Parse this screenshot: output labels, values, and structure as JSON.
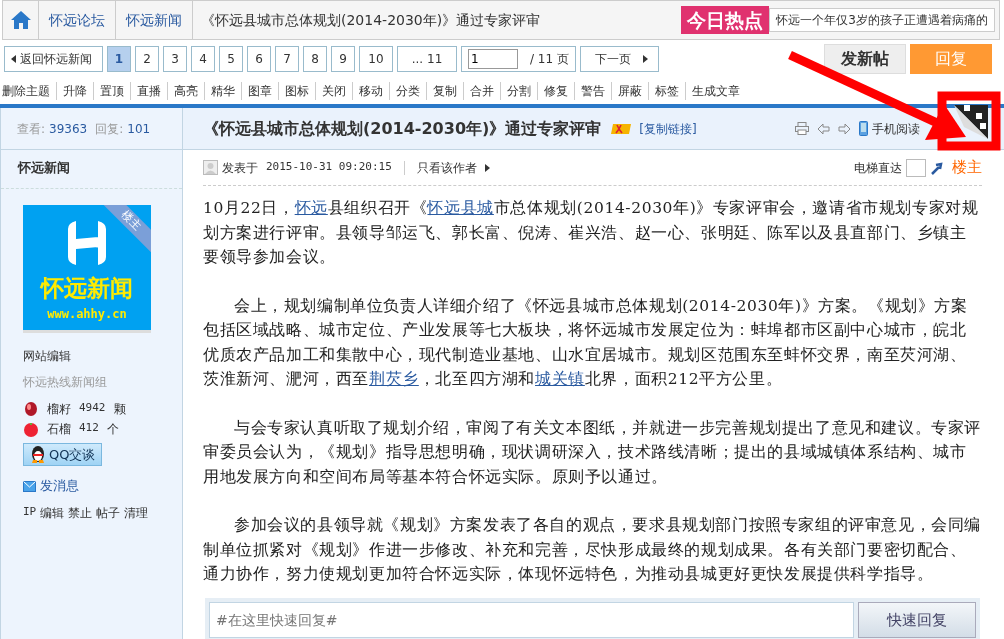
{
  "breadcrumb": {
    "items": [
      "怀远论坛",
      "怀远新闻"
    ],
    "current": "《怀远县城市总体规划(2014-2030年)》通过专家评审"
  },
  "hot": {
    "label": "今日热点",
    "headline": "怀远一个年仅3岁的孩子正遭遇着病痛的"
  },
  "pager": {
    "back": "返回怀远新闻",
    "pages": [
      {
        "label": "1",
        "selected": true
      },
      {
        "label": "2",
        "selected": false
      },
      {
        "label": "3",
        "selected": false
      },
      {
        "label": "4",
        "selected": false
      },
      {
        "label": "5",
        "selected": false
      },
      {
        "label": "6",
        "selected": false
      },
      {
        "label": "7",
        "selected": false
      },
      {
        "label": "8",
        "selected": false
      },
      {
        "label": "9",
        "selected": false
      },
      {
        "label": "10",
        "selected": false
      },
      {
        "label": "... 11",
        "selected": false
      }
    ],
    "page_input": "1",
    "total": "/ 11 页",
    "next": "下一页"
  },
  "actions": {
    "new_post": "发新帖",
    "reply": "回复"
  },
  "mod_tools": [
    "删除主题",
    "升降",
    "置顶",
    "直播",
    "高亮",
    "精华",
    "图章",
    "图标",
    "关闭",
    "移动",
    "分类",
    "复制",
    "合并",
    "分割",
    "修复",
    "警告",
    "屏蔽",
    "标签",
    "生成文章"
  ],
  "stats": {
    "views_label": "查看:",
    "views": "39363",
    "replies_label": "回复:",
    "replies": "101"
  },
  "author": {
    "name": "怀远新闻",
    "logo_text": "怀远新闻",
    "logo_url": "www.ahhy.cn",
    "ribbon": "楼主",
    "role": "网站编辑",
    "group": "怀远热线新闻组",
    "credits": [
      {
        "name": "榴籽",
        "value": "4942",
        "unit": "颗"
      },
      {
        "name": "石榴",
        "value": "412",
        "unit": "个"
      }
    ],
    "qq": "QQ交谈",
    "message": "发消息",
    "admin_label": "IP",
    "admin_links": [
      "编辑",
      "禁止",
      "帖子",
      "清理"
    ]
  },
  "post": {
    "title": "《怀远县城市总体规划(2014-2030年)》通过专家评审",
    "copy_link": "[复制链接]",
    "mobile": "手机阅读",
    "posted_label": "发表于",
    "posted_at": "2015-10-31 09:20:15",
    "author_only": "只看该作者",
    "jump_label": "电梯直达",
    "floor": "楼主",
    "paragraphs": [
      {
        "indent": false,
        "parts": [
          {
            "text": "10月22日，"
          },
          {
            "text": "怀远",
            "link": true
          },
          {
            "text": "县组织召开《"
          },
          {
            "text": "怀远县城",
            "link": true
          },
          {
            "text": "市总体规划(2014-2030年)》专家评审会，邀请省市规划专家对规划方案进行评审。县领导邹运飞、郭长富、倪涛、崔兴浩、赵一心、张明廷、陈军以及县直部门、乡镇主要领导参加会议。"
          }
        ]
      },
      {
        "indent": true,
        "parts": [
          {
            "text": "会上，规划编制单位负责人详细介绍了《怀远县城市总体规划(2014-2030年)》方案。《规划》方案包括区域战略、城市定位、产业发展等七大板块，将怀远城市发展定位为：蚌埠都市区副中心城市，皖北优质农产品加工和集散中心，现代制造业基地、山水宜居城市。规划区范围东至蚌怀交界，南至芡河湖、茨淮新河、淝河，西至"
          },
          {
            "text": "荆芡乡",
            "link": true
          },
          {
            "text": "，北至四方湖和"
          },
          {
            "text": "城关镇",
            "link": true
          },
          {
            "text": "北界，面积212平方公里。"
          }
        ]
      },
      {
        "indent": true,
        "parts": [
          {
            "text": "与会专家认真听取了规划介绍，审阅了有关文本图纸，并就进一步完善规划提出了意见和建议。专家评审委员会认为，《规划》指导思想明确，现状调研深入，技术路线清晰；提出的县域城镇体系结构、城市用地发展方向和空间布局等基本符合怀远实际。原则予以通过。"
          }
        ]
      },
      {
        "indent": true,
        "parts": [
          {
            "text": "参加会议的县领导就《规划》方案发表了各自的观点，要求县规划部门按照专家组的评审意见，会同编制单位抓紧对《规划》作进一步修改、补充和完善，尽快形成最终的规划成果。各有关部门要密切配合、通力协作，努力使规划更加符合怀远实际，体现怀远特色，为推动县城更好更快发展提供科学指导。"
          }
        ]
      }
    ]
  },
  "quick_reply": {
    "placeholder": "#在这里快速回复#",
    "button": "快速回复"
  }
}
